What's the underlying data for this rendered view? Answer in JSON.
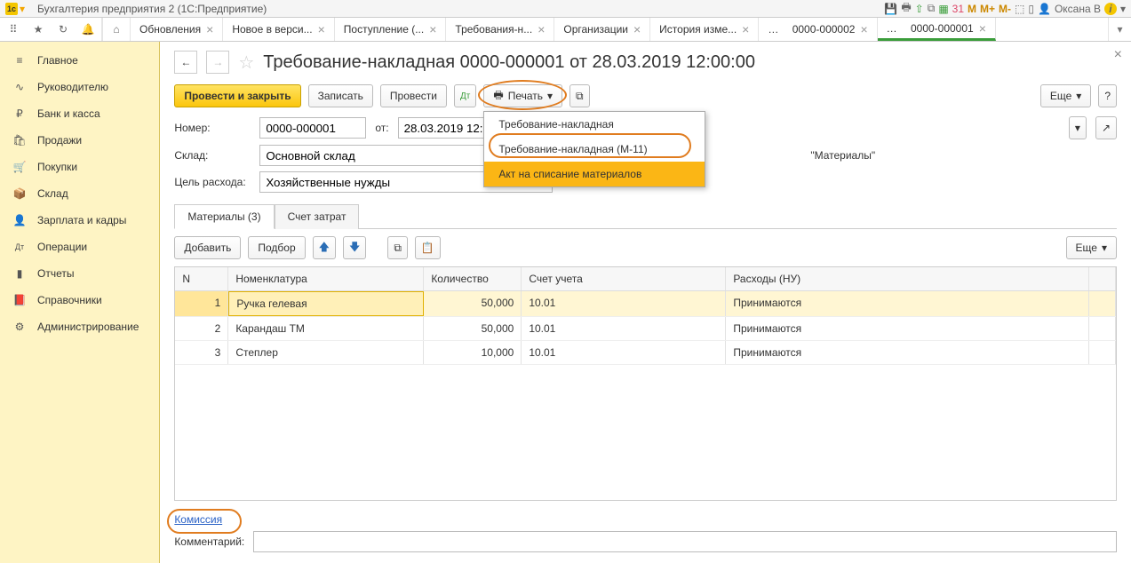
{
  "titlebar": {
    "app_title": "Бухгалтерия предприятия 2  (1С:Предприятие)",
    "user": "Оксана В",
    "mem_buttons": [
      "M",
      "M+",
      "M-"
    ]
  },
  "tabs": [
    {
      "label": "Обновления"
    },
    {
      "label": "Новое в верси..."
    },
    {
      "label": "Поступление (..."
    },
    {
      "label": "Требования-н..."
    },
    {
      "label": "Организации"
    },
    {
      "label": "История изме..."
    },
    {
      "label": "0000-000002"
    },
    {
      "label": "0000-000001",
      "active": true
    }
  ],
  "sidebar": [
    {
      "icon": "≡",
      "label": "Главное"
    },
    {
      "icon": "∿",
      "label": "Руководителю"
    },
    {
      "icon": "₽",
      "label": "Банк и касса"
    },
    {
      "icon": "🛍",
      "label": "Продажи"
    },
    {
      "icon": "🛒",
      "label": "Покупки"
    },
    {
      "icon": "📦",
      "label": "Склад"
    },
    {
      "icon": "👤",
      "label": "Зарплата и кадры"
    },
    {
      "icon": "Дт",
      "label": "Операции"
    },
    {
      "icon": "▮",
      "label": "Отчеты"
    },
    {
      "icon": "📕",
      "label": "Справочники"
    },
    {
      "icon": "⚙",
      "label": "Администрирование"
    }
  ],
  "doc": {
    "title": "Требование-накладная 0000-000001 от 28.03.2019 12:00:00",
    "toolbar": {
      "post_close": "Провести и закрыть",
      "save": "Записать",
      "post": "Провести",
      "print": "Печать",
      "more": "Еще"
    },
    "print_menu": [
      "Требование-накладная",
      "Требование-накладная (М-11)",
      "Акт на списание материалов"
    ],
    "fields": {
      "number_label": "Номер:",
      "number": "0000-000001",
      "date_label": "от:",
      "date": "28.03.2019 12:00:00",
      "warehouse_label": "Склад:",
      "warehouse": "Основной склад",
      "account_suffix": "\"Материалы\"",
      "purpose_label": "Цель расхода:",
      "purpose": "Хозяйственные нужды"
    },
    "tabs2": {
      "materials": "Материалы (3)",
      "cost": "Счет затрат"
    },
    "grid_toolbar": {
      "add": "Добавить",
      "pick": "Подбор",
      "more": "Еще"
    },
    "columns": {
      "n": "N",
      "nom": "Номенклатура",
      "qty": "Количество",
      "acc": "Счет учета",
      "exp": "Расходы (НУ)"
    },
    "rows": [
      {
        "n": "1",
        "nom": "Ручка гелевая",
        "qty": "50,000",
        "acc": "10.01",
        "exp": "Принимаются"
      },
      {
        "n": "2",
        "nom": "Карандаш ТМ",
        "qty": "50,000",
        "acc": "10.01",
        "exp": "Принимаются"
      },
      {
        "n": "3",
        "nom": "Степлер",
        "qty": "10,000",
        "acc": "10.01",
        "exp": "Принимаются"
      }
    ],
    "footer": {
      "commission": "Комиссия",
      "comment_label": "Комментарий:"
    }
  }
}
